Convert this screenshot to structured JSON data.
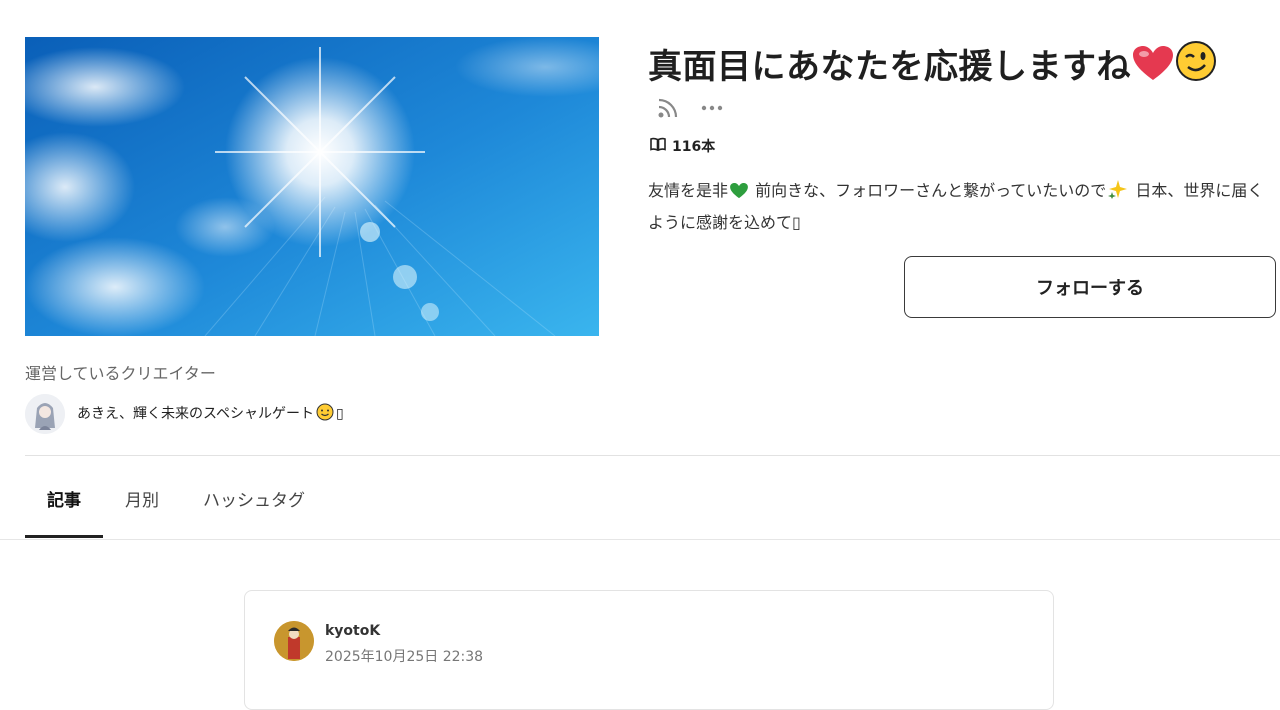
{
  "magazine": {
    "title": "真面目にあなたを応援しますね",
    "title_emojis": [
      "heart-emoji",
      "wink-emoji"
    ],
    "article_count": "116本",
    "description_part1": "友情を是非",
    "description_part2": " 前向きな、フォロワーさんと繋がっていたいので",
    "description_part3": " 日本、世界に届くように感謝を込めて",
    "description_trailing_glyph": "▯",
    "follow_label": "フォローする"
  },
  "creator": {
    "heading": "運営しているクリエイター",
    "name": "あきえ、輝く未来のスペシャルゲート",
    "name_trailing_glyph": "▯"
  },
  "tabs": [
    {
      "label": "記事",
      "active": true
    },
    {
      "label": "月別",
      "active": false
    },
    {
      "label": "ハッシュタグ",
      "active": false
    }
  ],
  "post": {
    "author": "kyotoK",
    "date": "2025年10月25日 22:38"
  },
  "colors": {
    "sky_dark": "#1565c0",
    "sky_light": "#4fc3f7",
    "heart": "#e53950",
    "green_heart": "#2e9e3e",
    "emoji_yellow": "#ffcc33"
  },
  "icons": {
    "rss": "rss-icon",
    "more": "more-dots-icon",
    "count": "open-book-icon"
  }
}
